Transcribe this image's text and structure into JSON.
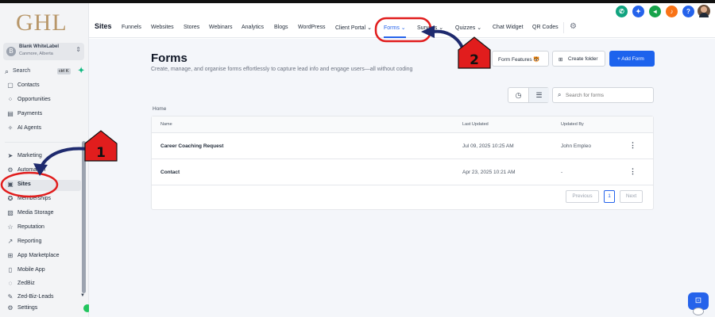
{
  "app": {
    "logo": "GHL",
    "account_name": "Blank WhiteLabel",
    "account_location": "Canmore, Alberta",
    "account_avatar": "B"
  },
  "sidebar": {
    "search_label": "Search",
    "search_shortcut": "ctrl K",
    "items": [
      {
        "label": "Contacts",
        "icon": "contacts-icon",
        "glyph": "▢"
      },
      {
        "label": "Opportunities",
        "icon": "opportunities-icon",
        "glyph": "⁘"
      },
      {
        "label": "Payments",
        "icon": "payments-icon",
        "glyph": "▤"
      },
      {
        "label": "AI Agents",
        "icon": "ai-agents-icon",
        "glyph": "✧"
      },
      {
        "label": "Marketing",
        "icon": "marketing-icon",
        "glyph": "➤"
      },
      {
        "label": "Automation",
        "icon": "automation-icon",
        "glyph": "⚙"
      },
      {
        "label": "Sites",
        "icon": "sites-icon",
        "glyph": "▣"
      },
      {
        "label": "Memberships",
        "icon": "memberships-icon",
        "glyph": "✪"
      },
      {
        "label": "Media Storage",
        "icon": "media-storage-icon",
        "glyph": "▧"
      },
      {
        "label": "Reputation",
        "icon": "reputation-icon",
        "glyph": "☆"
      },
      {
        "label": "Reporting",
        "icon": "reporting-icon",
        "glyph": "↗"
      },
      {
        "label": "App Marketplace",
        "icon": "app-marketplace-icon",
        "glyph": "⊞"
      },
      {
        "label": "Mobile App",
        "icon": "mobile-app-icon",
        "glyph": "▯"
      },
      {
        "label": "ZedBiz",
        "icon": "zedbiz-icon",
        "glyph": "◌"
      },
      {
        "label": "Zed-Biz-Leads",
        "icon": "zed-biz-leads-icon",
        "glyph": "✎"
      },
      {
        "label": "Settings",
        "icon": "settings-icon",
        "glyph": "⚙"
      }
    ],
    "active_item": "Sites"
  },
  "topnav": {
    "section_title": "Sites",
    "tabs": [
      {
        "label": "Funnels"
      },
      {
        "label": "Websites"
      },
      {
        "label": "Stores"
      },
      {
        "label": "Webinars"
      },
      {
        "label": "Analytics"
      },
      {
        "label": "Blogs"
      },
      {
        "label": "WordPress"
      },
      {
        "label": "Client Portal ⌄"
      },
      {
        "label": "Forms ⌄"
      },
      {
        "label": "Surveys ⌄"
      },
      {
        "label": "Quizzes ⌄"
      },
      {
        "label": "Chat Widget"
      },
      {
        "label": "QR Codes"
      }
    ],
    "active_tab": "Forms"
  },
  "top_icons": [
    {
      "name": "phone-icon",
      "color": "#10a37f",
      "glyph": "✆"
    },
    {
      "name": "magic-wand-icon",
      "color": "#2563eb",
      "glyph": "✦"
    },
    {
      "name": "megaphone-icon",
      "color": "#16a34a",
      "glyph": "◂"
    },
    {
      "name": "bell-icon",
      "color": "#f97316",
      "glyph": "♪"
    },
    {
      "name": "help-icon",
      "color": "#2563eb",
      "glyph": "?"
    }
  ],
  "main": {
    "title": "Forms",
    "subtitle": "Create, manage, and organise forms effortlessly to capture lead info and engage users—all without coding",
    "buttons": {
      "form_features": "Form Features 🐯",
      "create_folder": "Create folder",
      "add_form": "+ Add Form"
    },
    "search_placeholder": "Search for forms",
    "breadcrumb": "Home",
    "table": {
      "headers": [
        "Name",
        "Last Updated",
        "Updated By"
      ],
      "rows": [
        {
          "name": "Career Coaching Request",
          "updated": "Jul 09, 2025 10:25 AM",
          "by": "John Empleo"
        },
        {
          "name": "Contact",
          "updated": "Apr 23, 2025 10:21 AM",
          "by": "-"
        }
      ]
    },
    "pagination": {
      "previous": "Previous",
      "current": "1",
      "next": "Next"
    }
  },
  "annotations": [
    {
      "label": "1",
      "color": "#e11d1d"
    },
    {
      "label": "2",
      "color": "#e11d1d"
    }
  ],
  "colors": {
    "primary": "#1d63ed",
    "annotation_red": "#e11d1d",
    "annotation_arrow": "#1e2a6e"
  }
}
